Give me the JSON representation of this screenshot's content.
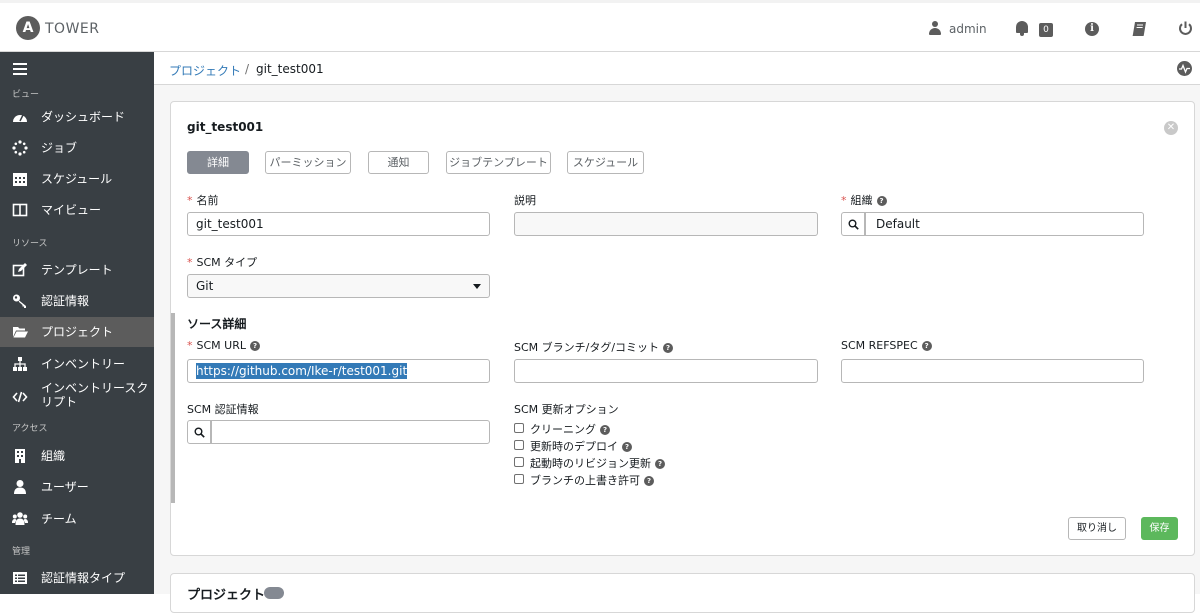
{
  "header": {
    "logo_letter": "A",
    "brand": "TOWER",
    "user": "admin",
    "notification_count": "0",
    "info_symbol": "i"
  },
  "sidebar": {
    "sections": {
      "view": "ビュー",
      "resources": "リソース",
      "access": "アクセス",
      "admin": "管理"
    },
    "items": [
      {
        "label": "ダッシュボード",
        "icon": "dashboard-icon"
      },
      {
        "label": "ジョブ",
        "icon": "jobs-icon"
      },
      {
        "label": "スケジュール",
        "icon": "calendar-icon"
      },
      {
        "label": "マイビュー",
        "icon": "columns-icon"
      },
      {
        "label": "テンプレート",
        "icon": "edit-icon"
      },
      {
        "label": "認証情報",
        "icon": "key-icon"
      },
      {
        "label": "プロジェクト",
        "icon": "folder-icon"
      },
      {
        "label": "インベントリー",
        "icon": "sitemap-icon"
      },
      {
        "label": "インベントリースク",
        "label2": "リプト",
        "icon": "code-icon"
      },
      {
        "label": "組織",
        "icon": "building-icon"
      },
      {
        "label": "ユーザー",
        "icon": "user-icon"
      },
      {
        "label": "チーム",
        "icon": "users-icon"
      },
      {
        "label": "認証情報タイプ",
        "icon": "list-icon"
      }
    ]
  },
  "breadcrumb": {
    "parent": "プロジェクト",
    "separator": "/",
    "current": "git_test001"
  },
  "form": {
    "title": "git_test001",
    "tabs": [
      "詳細",
      "パーミッション",
      "通知",
      "ジョブテンプレート",
      "スケジュール"
    ],
    "name_label": "名前",
    "name_value": "git_test001",
    "description_label": "説明",
    "description_value": "",
    "org_label": "組織",
    "org_value": "Default",
    "scm_type_label": "SCM タイプ",
    "scm_type_value": "Git",
    "source_details_title": "ソース詳細",
    "scm_url_label": "SCM URL",
    "scm_url_value": "https://github.com/Ike-r/test001.git",
    "scm_branch_label": "SCM ブランチ/タグ/コミット",
    "scm_branch_value": "",
    "scm_refspec_label": "SCM REFSPEC",
    "scm_refspec_value": "",
    "scm_credential_label": "SCM 認証情報",
    "scm_credential_value": "",
    "update_options_label": "SCM 更新オプション",
    "options": [
      {
        "label": "クリーニング",
        "checked": false
      },
      {
        "label": "更新時のデプロイ",
        "checked": false
      },
      {
        "label": "起動時のリビジョン更新",
        "checked": false
      },
      {
        "label": "ブランチの上書き許可",
        "checked": false
      }
    ],
    "required_mark": "*",
    "help_symbol": "?",
    "cancel_label": "取り消し",
    "save_label": "保存"
  },
  "colors": {
    "sidebar_bg": "#393f44",
    "active_tab_bg": "#848992",
    "link": "#337ab7",
    "save_bg": "#5cb85c",
    "required": "#d9534f"
  }
}
